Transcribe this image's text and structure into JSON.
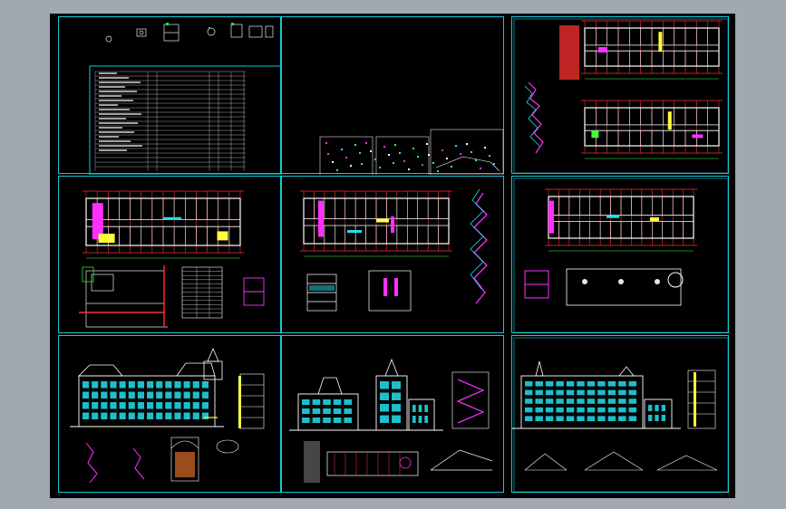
{
  "drawing": {
    "title": "",
    "sheet_count": 9,
    "sheets": [
      {
        "id": "sheet-1",
        "content": "drawing-index-and-schedule"
      },
      {
        "id": "sheet-2",
        "content": "site-plan-and-details"
      },
      {
        "id": "sheet-3",
        "content": "floor-plans-pair"
      },
      {
        "id": "sheet-4",
        "content": "ground-floor-plan"
      },
      {
        "id": "sheet-5",
        "content": "second-floor-plan-and-stair"
      },
      {
        "id": "sheet-6",
        "content": "third-floor-plan-and-roof"
      },
      {
        "id": "sheet-7",
        "content": "front-elevation"
      },
      {
        "id": "sheet-8",
        "content": "side-elevation"
      },
      {
        "id": "sheet-9",
        "content": "rear-elevation"
      }
    ]
  },
  "colors": {
    "background": "#000000",
    "border": "#15c8d8",
    "wall": "#ffffff",
    "grid": "#ff3030",
    "accent_cyan": "#22e0f0",
    "accent_magenta": "#ff30ff",
    "accent_yellow": "#ffff40",
    "accent_green": "#40ff40"
  }
}
